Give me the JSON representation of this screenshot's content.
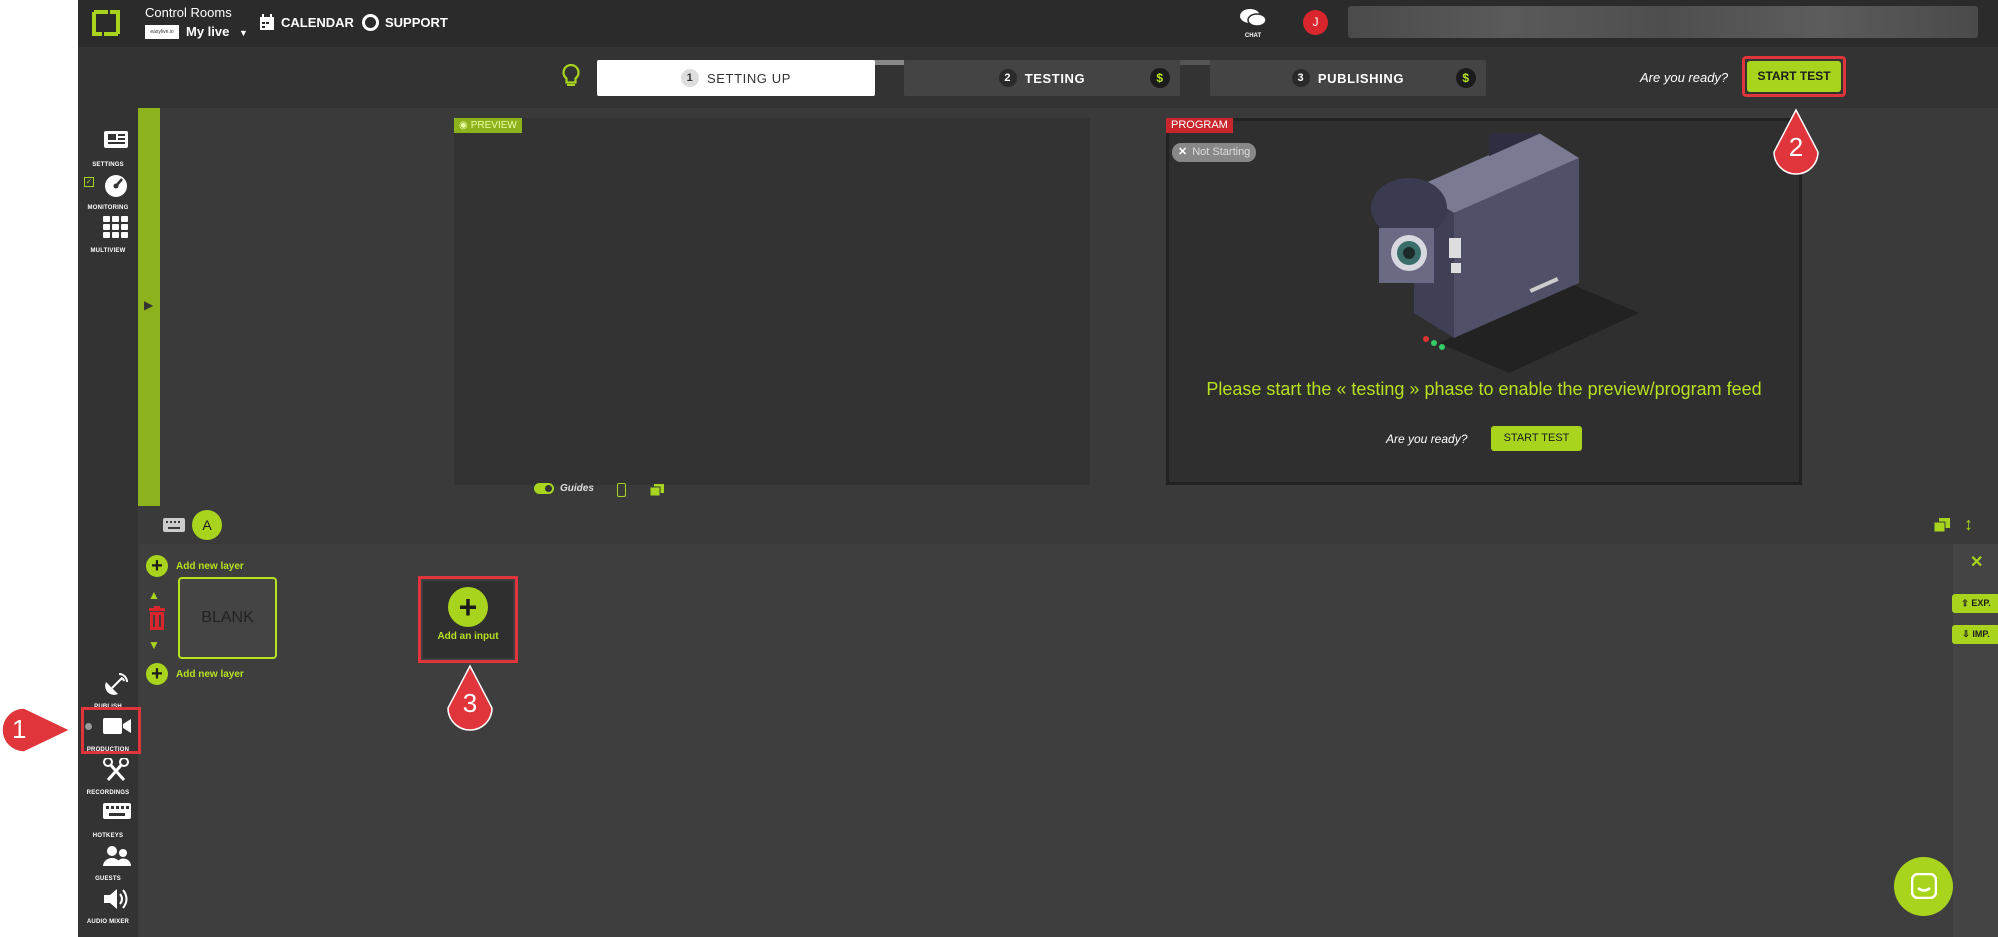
{
  "header": {
    "brand": "Control Rooms",
    "live_name": "My live",
    "org_logo_text": "easylive.io",
    "calendar": "CALENDAR",
    "support": "SUPPORT",
    "chat": "CHAT",
    "avatar_initial": "J"
  },
  "steps": [
    {
      "num": "1",
      "label": "SETTING UP"
    },
    {
      "num": "2",
      "label": "TESTING",
      "badge": "$"
    },
    {
      "num": "3",
      "label": "PUBLISHING",
      "badge": "$"
    }
  ],
  "ready_prompt": "Are you ready?",
  "start_test": "START TEST",
  "nav_top": [
    {
      "label": "SETTINGS",
      "icon": "newspaper-icon"
    },
    {
      "label": "MONITORING",
      "icon": "speedometer-icon"
    },
    {
      "label": "MULTIVIEW",
      "icon": "grid-icon"
    }
  ],
  "nav_bottom": [
    {
      "label": "PUBLISH",
      "icon": "satellite-dish-icon"
    },
    {
      "label": "PRODUCTION",
      "icon": "video-camera-icon"
    },
    {
      "label": "RECORDINGS",
      "icon": "scissors-icon"
    },
    {
      "label": "HOTKEYS",
      "icon": "keyboard-icon"
    },
    {
      "label": "GUESTS",
      "icon": "users-icon"
    },
    {
      "label": "AUDIO MIXER",
      "icon": "speaker-icon"
    }
  ],
  "preview": {
    "label": "PREVIEW",
    "guides": "Guides"
  },
  "program": {
    "label": "PROGRAM",
    "status": "Not Starting",
    "message": "Please start the « testing » phase to enable the preview/program feed"
  },
  "scene": {
    "tab": "A",
    "add_layer_top": "Add new layer",
    "add_layer_bottom": "Add new layer",
    "blank": "BLANK",
    "add_input": "Add an input"
  },
  "right_panel": {
    "export": "EXP.",
    "import": "IMP."
  },
  "callouts": [
    "1",
    "2",
    "3"
  ],
  "colors": {
    "accent": "#a8d41e",
    "callout": "#e0353a",
    "bg": "#3c3c3c"
  }
}
